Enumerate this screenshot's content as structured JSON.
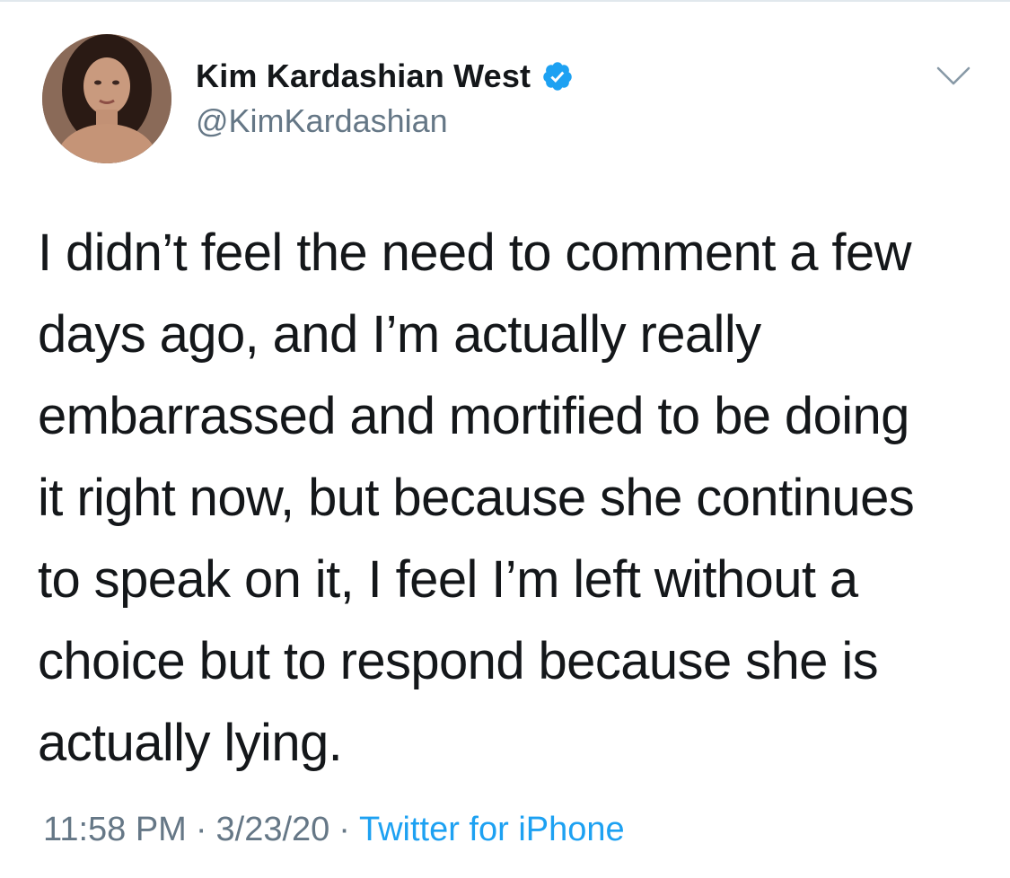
{
  "user": {
    "display_name": "Kim Kardashian West",
    "handle": "@KimKardashian",
    "verified": true,
    "avatar_icon": "profile-photo",
    "verified_icon": "verified-badge-icon"
  },
  "menu": {
    "icon": "chevron-down-icon"
  },
  "tweet": {
    "lines": [
      "I didn’t feel the need to comment a few",
      "days ago, and I’m actually really",
      "embarrassed and mortified to be doing",
      "it right now, but because she continues",
      "to speak on it, I feel I’m left without a",
      "choice but to respond because she is",
      "actually lying."
    ]
  },
  "meta": {
    "time": "11:58 PM",
    "separator": "·",
    "date": "3/23/20",
    "source": "Twitter for iPhone"
  },
  "colors": {
    "text_primary": "#14171a",
    "text_secondary": "#657786",
    "accent": "#1da1f2",
    "divider": "#e1e8ed"
  }
}
